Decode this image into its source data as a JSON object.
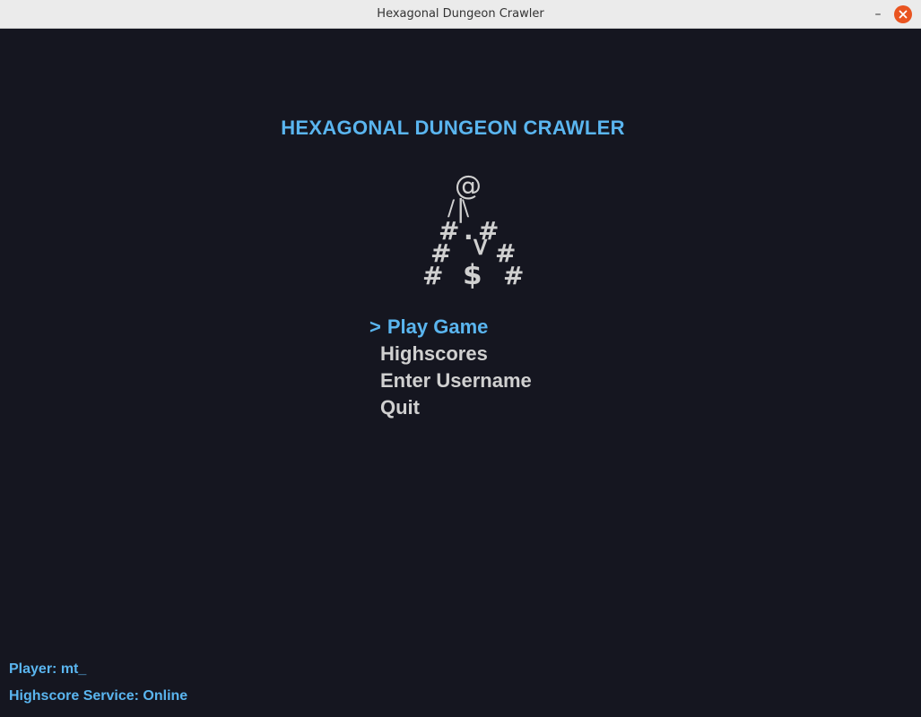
{
  "window": {
    "title": "Hexagonal Dungeon Crawler",
    "minimize_symbol": "–"
  },
  "game": {
    "title": "HEXAGONAL DUNGEON CRAWLER",
    "ascii_art": {
      "player": "@",
      "arm_left": "/",
      "arm_mid": "|",
      "arm_right": "\\",
      "wall": "#",
      "floor": ".",
      "stairs": ">",
      "gold": "$"
    },
    "menu": {
      "cursor": ">",
      "items": [
        "Play Game",
        "Highscores",
        "Enter Username",
        "Quit"
      ]
    },
    "status": {
      "player_label": "Player: mt_",
      "service_label": "Highscore Service: Online"
    }
  },
  "colors": {
    "background": "#151620",
    "accent": "#5ab5ef",
    "text": "#d0d0d0",
    "close_button": "#e95420"
  }
}
